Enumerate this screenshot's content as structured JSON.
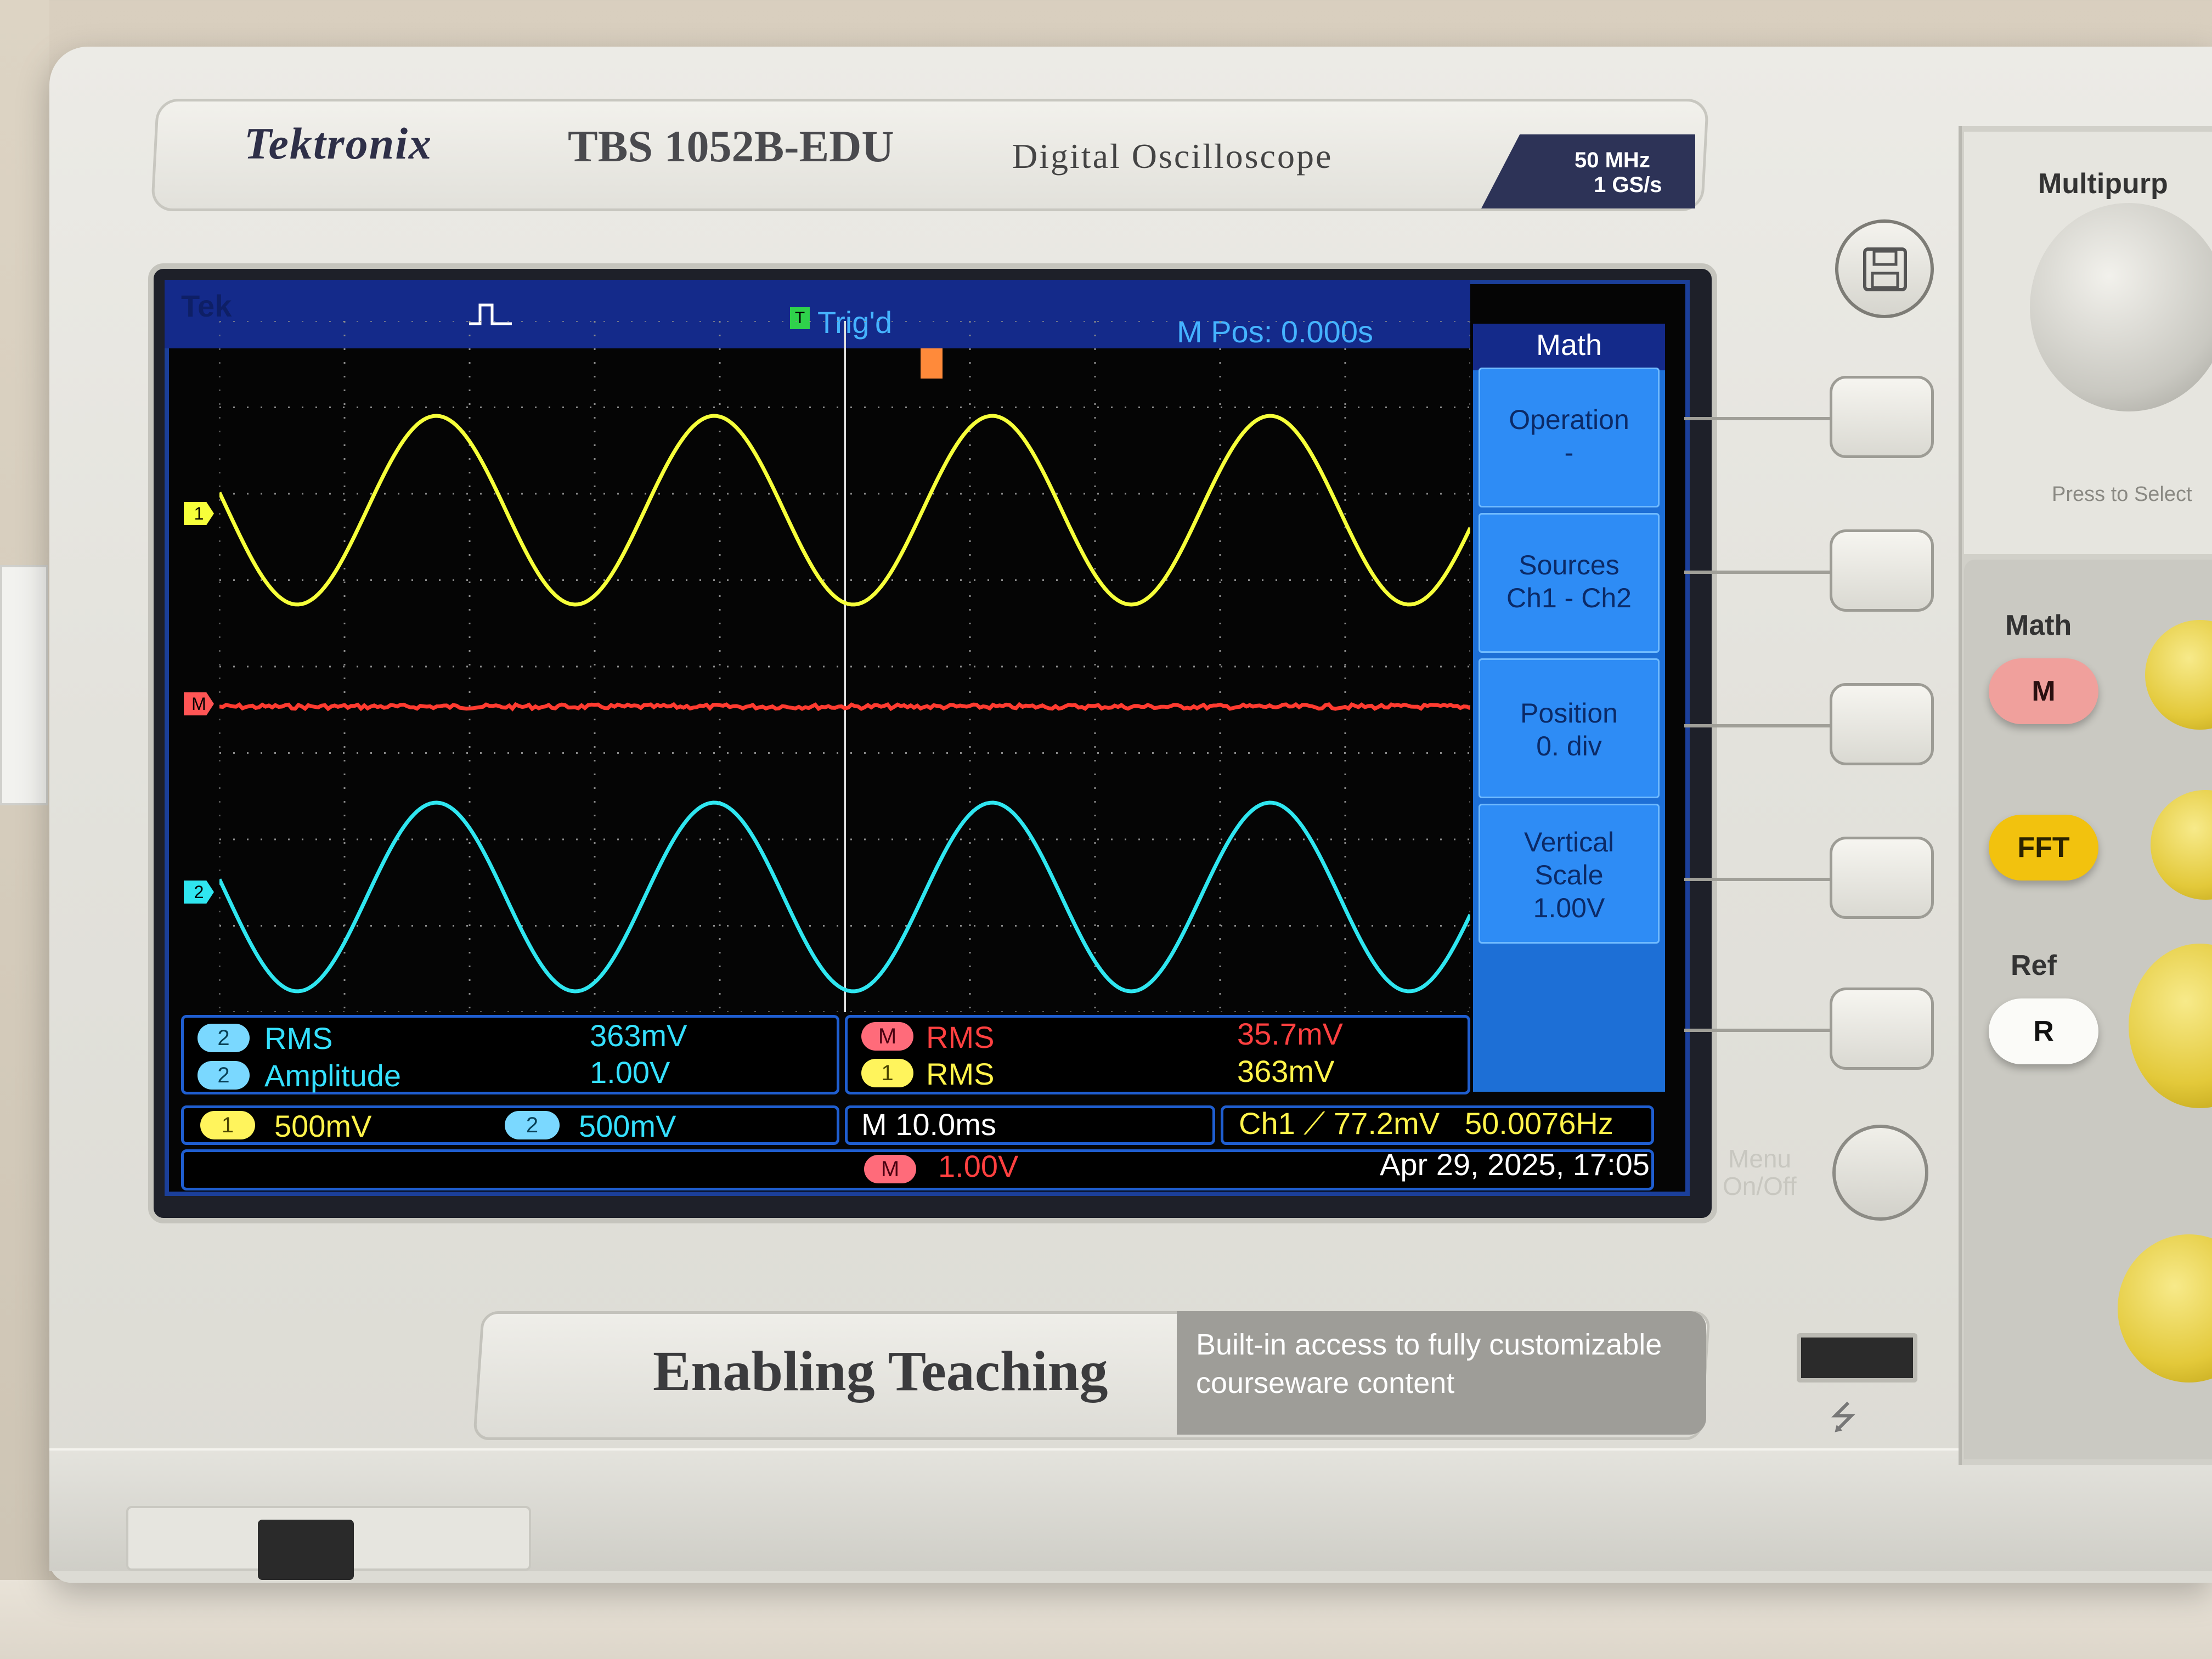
{
  "nameplate": {
    "brand": "Tektronix",
    "model": "TBS 1052B-EDU",
    "description": "Digital Oscilloscope",
    "spec_line_1": "50 MHz",
    "spec_line_2": "1 GS/s"
  },
  "screen": {
    "top_bar": {
      "brand_tag": "Tek",
      "trigger_status": "Trig'd",
      "trigger_icon": "T",
      "m_pos": "M Pos: 0.000s"
    },
    "markers": {
      "ch1": "1",
      "math": "M",
      "ch2": "2"
    },
    "waveforms": {
      "ch1_color": "#f6ff3a",
      "ch2_color": "#2fe6f0",
      "math_color": "#ff3b30",
      "cycles_visible": 4.5
    },
    "menu": {
      "title": "Math",
      "items": [
        {
          "label": "Operation",
          "value": "-"
        },
        {
          "label": "Sources",
          "value": "Ch1 - Ch2"
        },
        {
          "label": "Position",
          "value": "0. div"
        },
        {
          "label": "Vertical",
          "label2": "Scale",
          "value": "1.00V"
        }
      ]
    },
    "measurements_left": [
      {
        "badge": "2",
        "name": "RMS",
        "value": "363mV"
      },
      {
        "badge": "2",
        "name": "Amplitude",
        "value": "1.00V"
      }
    ],
    "measurements_right": [
      {
        "badge": "M",
        "name": "RMS",
        "value": "35.7mV"
      },
      {
        "badge": "1",
        "name": "RMS",
        "value": "363mV"
      }
    ],
    "status": {
      "ch1_badge": "1",
      "ch1_scale": "500mV",
      "ch2_badge": "2",
      "ch2_scale": "500mV",
      "timebase": "M 10.0ms",
      "trigger": "Ch1 ⟋ 77.2mV",
      "frequency": "50.0076Hz",
      "math_badge": "M",
      "math_scale": "1.00V",
      "datetime": "Apr 29, 2025, 17:05"
    }
  },
  "panel": {
    "multipurpose_label": "Multipurp",
    "press_hint": "Press to Select",
    "math_label": "Math",
    "math_button": "M",
    "fft_button": "FFT",
    "ref_label": "Ref",
    "ref_button": "R",
    "menu_label_1": "Menu",
    "menu_label_2": "On/Off"
  },
  "plaque": {
    "title": "Enabling Teaching",
    "subtitle_1": "Built-in access to fully customizable",
    "subtitle_2": "courseware content"
  }
}
